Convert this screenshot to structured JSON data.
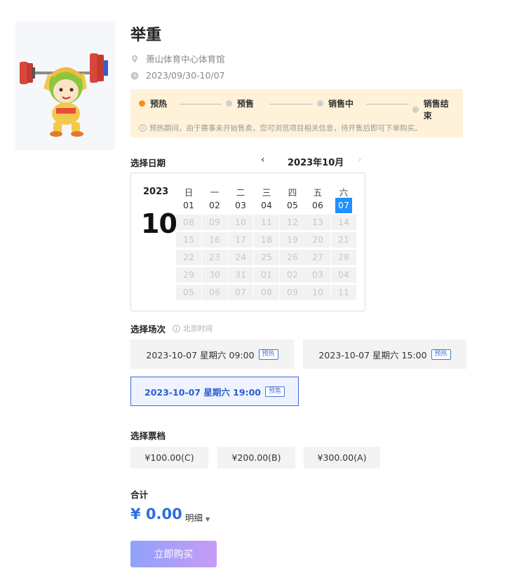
{
  "event": {
    "title": "举重",
    "venue": "萧山体育中心体育馆",
    "date_range": "2023/09/30-10/07"
  },
  "progress": {
    "steps": [
      {
        "label": "预热",
        "active": true
      },
      {
        "label": "预售",
        "active": false
      },
      {
        "label": "销售中",
        "active": false
      },
      {
        "label": "销售结束",
        "active": false
      }
    ],
    "notice": "预热期间，由于赛事未开始售卖，您可浏览项目相关信息，待开售后即可下单购买。"
  },
  "date_section": {
    "label": "选择日期",
    "month_title": "2023年10月",
    "prev_icon": "‹",
    "next_icon": "›"
  },
  "calendar": {
    "year": "2023",
    "month": "10",
    "weekdays": [
      "日",
      "一",
      "二",
      "三",
      "四",
      "五",
      "六"
    ],
    "weeks": [
      [
        "01",
        "02",
        "03",
        "04",
        "05",
        "06",
        "07"
      ],
      [
        "08",
        "09",
        "10",
        "11",
        "12",
        "13",
        "14"
      ],
      [
        "15",
        "16",
        "17",
        "18",
        "19",
        "20",
        "21"
      ],
      [
        "22",
        "23",
        "24",
        "25",
        "26",
        "27",
        "28"
      ],
      [
        "29",
        "30",
        "31",
        "01",
        "02",
        "03",
        "04"
      ],
      [
        "05",
        "06",
        "07",
        "08",
        "09",
        "10",
        "11"
      ]
    ],
    "enabled_row": 0,
    "selected_day": "07"
  },
  "session_section": {
    "label": "选择场次",
    "note": "北京时间",
    "sessions": [
      {
        "text": "2023-10-07 星期六 09:00",
        "tag": "预热",
        "selected": false
      },
      {
        "text": "2023-10-07 星期六 15:00",
        "tag": "预热",
        "selected": false
      },
      {
        "text": "2023-10-07 星期六 19:00",
        "tag": "预售",
        "selected": true
      }
    ]
  },
  "ticket_section": {
    "label": "选择票档",
    "tickets": [
      "¥100.00(C)",
      "¥200.00(B)",
      "¥300.00(A)"
    ]
  },
  "total": {
    "label": "合计",
    "amount": "¥ 0.00",
    "detail_label": "明细"
  },
  "buy_button": "立即购买",
  "colors": {
    "accent_blue": "#2d6ee0",
    "selected_day": "#1e90ff",
    "progress_bg": "#fff2d9",
    "active_dot": "#ff8c1a"
  }
}
